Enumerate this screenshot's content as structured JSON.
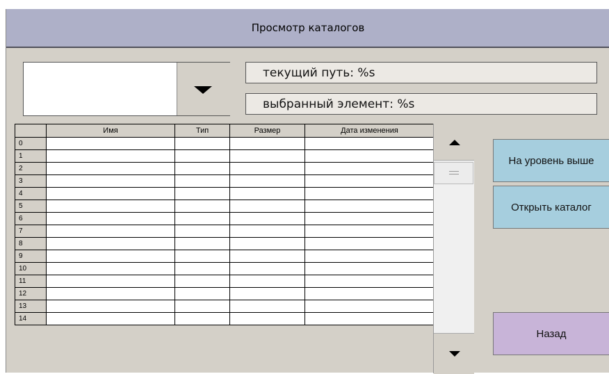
{
  "window": {
    "title": "Просмотр каталогов"
  },
  "path": {
    "current_path": "текущий путь: %s",
    "selected_item": "выбранный элемент: %s"
  },
  "table": {
    "columns": [
      "",
      "Имя",
      "Тип",
      "Размер",
      "Дата изменения"
    ],
    "rows": [
      "0",
      "1",
      "2",
      "3",
      "4",
      "5",
      "6",
      "7",
      "8",
      "9",
      "10",
      "11",
      "12",
      "13",
      "14"
    ]
  },
  "buttons": {
    "level_up": "На уровень выше",
    "open_dir": "Открыть каталог",
    "back": "Назад"
  },
  "colors": {
    "title_bar": "#aeb0c8",
    "panel": "#d4d0c8",
    "button_blue": "#a6cede",
    "button_purple": "#c8b4d8"
  }
}
